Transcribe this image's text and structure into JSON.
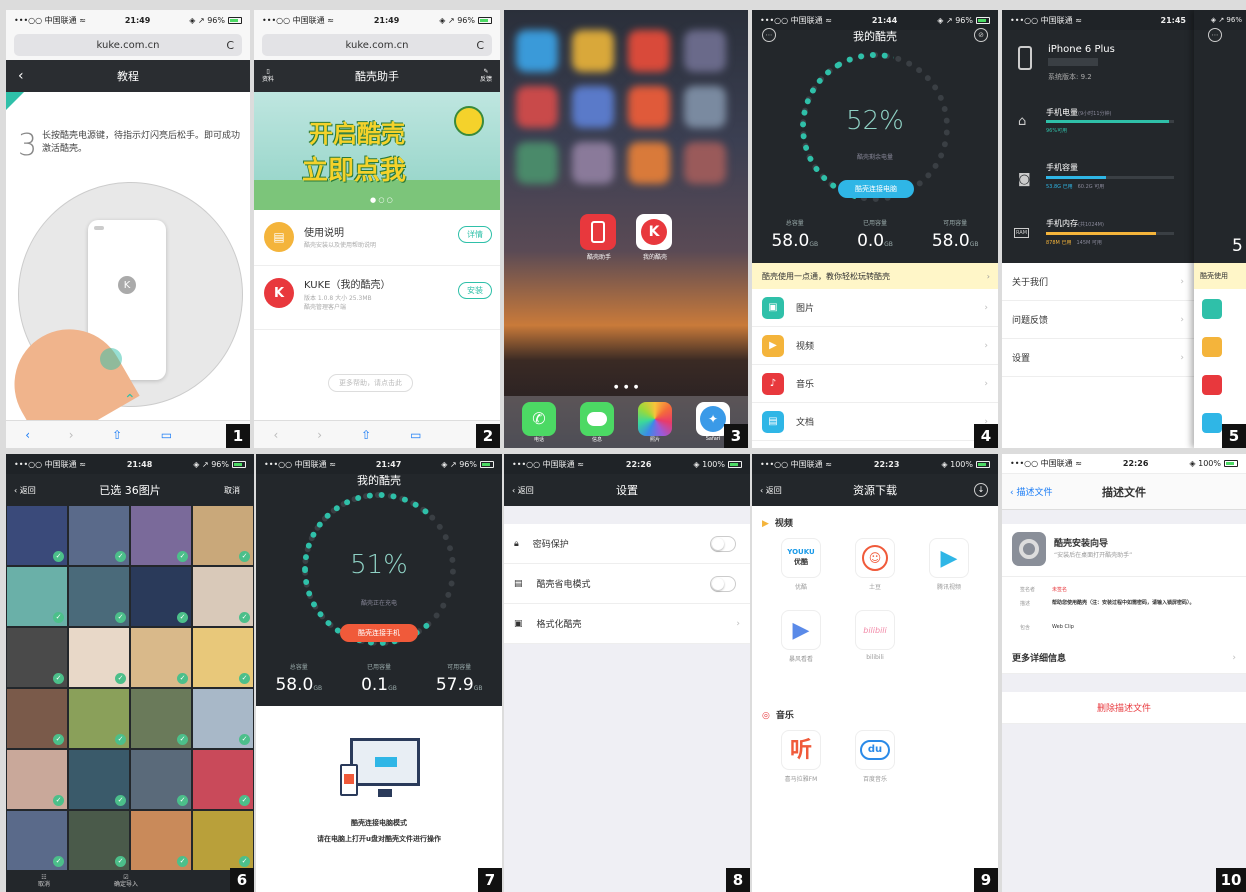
{
  "status": {
    "carrier": "•••○○ 中国联通 ≈",
    "t1": "21:49",
    "t2": "21:49",
    "t4": "21:44",
    "t5": "21:45",
    "t6": "21:48",
    "t7": "21:47",
    "t8": "22:26",
    "t9": "22:23",
    "t10": "22:26",
    "bat96": "◈ ↗ 96%",
    "bat100": "◈ 100%"
  },
  "browser": {
    "url": "kuke.com.cn",
    "reload": "C"
  },
  "p1": {
    "title": "教程",
    "step_num": "3",
    "step_text": "长按酷壳电源键，待指示灯闪亮后松手。即可成功激活酷壳。"
  },
  "p2": {
    "title": "酷壳助手",
    "left_icon_label": "资料",
    "right_icon_label": "反馈",
    "banner_l1": "开启酷壳",
    "banner_l2": "立即点我",
    "item1_title": "使用说明",
    "item1_sub": "酷壳安装以及使用帮助说明",
    "item1_btn": "详情",
    "item2_title": "KUKE（我的酷壳）",
    "item2_sub1": "版本 1.0.8  大小 25.3MB",
    "item2_sub2": "酷壳管理客户端",
    "item2_btn": "安装",
    "footer": "更多帮助，请点击此"
  },
  "p3": {
    "app1": "酷壳助手",
    "app2": "我的酷壳",
    "dock": [
      "电话",
      "信息",
      "照片",
      "Safari"
    ]
  },
  "p4": {
    "title": "我的酷壳",
    "percent": "52%",
    "gauge_label": "酷壳剩余电量",
    "connect_btn": "酷壳连接电脑",
    "stats": [
      {
        "label": "总容量",
        "value": "58.0",
        "unit": "GB"
      },
      {
        "label": "已用容量",
        "value": "0.0",
        "unit": "GB"
      },
      {
        "label": "可用容量",
        "value": "58.0",
        "unit": "GB"
      }
    ],
    "banner": "酷壳使用一点通，教你轻松玩转酷壳",
    "rows": [
      "图片",
      "视频",
      "音乐",
      "文档"
    ]
  },
  "p5": {
    "device": "iPhone 6 Plus",
    "sys": "系统版本: 9.2",
    "battery": "手机电量",
    "battery_note": "(9小时11分钟)",
    "battery_val": "96%可用",
    "battery_pct": 96,
    "storage": "手机容量",
    "storage_used": "53.8G 已用",
    "storage_free": "60.2G 可用",
    "storage_pct": 47,
    "ram": "手机内存",
    "ram_note": "(共1024M)",
    "ram_used": "878M 已用",
    "ram_free": "145M 可用",
    "ram_pct": 86,
    "ram_chip": "RAM",
    "big_num": "5",
    "banner_cut": "酷壳使用",
    "menu": [
      "关于我们",
      "问题反馈",
      "设置"
    ]
  },
  "p6": {
    "back": "返回",
    "title": "已选 36图片",
    "cancel": "取消",
    "bottom_left": "取消",
    "bottom_right": "确定导入"
  },
  "p7": {
    "title": "我的酷壳",
    "percent": "51%",
    "gauge_label": "酷壳正在充电",
    "connect_btn": "酷壳连接手机",
    "stats": [
      {
        "label": "总容量",
        "value": "58.0",
        "unit": "GB"
      },
      {
        "label": "已用容量",
        "value": "0.1",
        "unit": "GB"
      },
      {
        "label": "可用容量",
        "value": "57.9",
        "unit": "GB"
      }
    ],
    "mode_title": "酷壳连接电脑模式",
    "mode_desc": "请在电脑上打开u盘对酷壳文件进行操作"
  },
  "p8": {
    "back": "返回",
    "title": "设置",
    "rows": [
      "密码保护",
      "酷壳省电模式",
      "格式化酷壳"
    ]
  },
  "p9": {
    "back": "返回",
    "title": "资源下载",
    "sec_video": "视频",
    "sec_music": "音乐",
    "video_apps": [
      "优酷",
      "土豆",
      "腾讯视频",
      "暴风看看",
      "bilibili"
    ],
    "music_apps": [
      "喜马拉雅FM",
      "百度音乐"
    ],
    "youku_logo": "YOUKU",
    "youku_cn": "优酷",
    "listen_glyph": "听",
    "du_glyph": "du",
    "bili_glyph": "bilibili"
  },
  "p10": {
    "back": "描述文件",
    "title": "描述文件",
    "profile_name": "酷壳安装向导",
    "profile_sub": "“安装后在桌面打开酷壳助手”",
    "signed_label": "签名者",
    "signed_val": "未签名",
    "desc_label": "描述",
    "desc_val": "帮助您使用酷壳（注：安装过程中如需密码，请输入锁屏密码）。",
    "contains_label": "包含",
    "contains_val": "Web Clip",
    "more": "更多详细信息",
    "delete": "删除描述文件"
  },
  "panel_numbers": [
    "1",
    "2",
    "3",
    "4",
    "5",
    "6",
    "7",
    "8",
    "9",
    "10"
  ]
}
